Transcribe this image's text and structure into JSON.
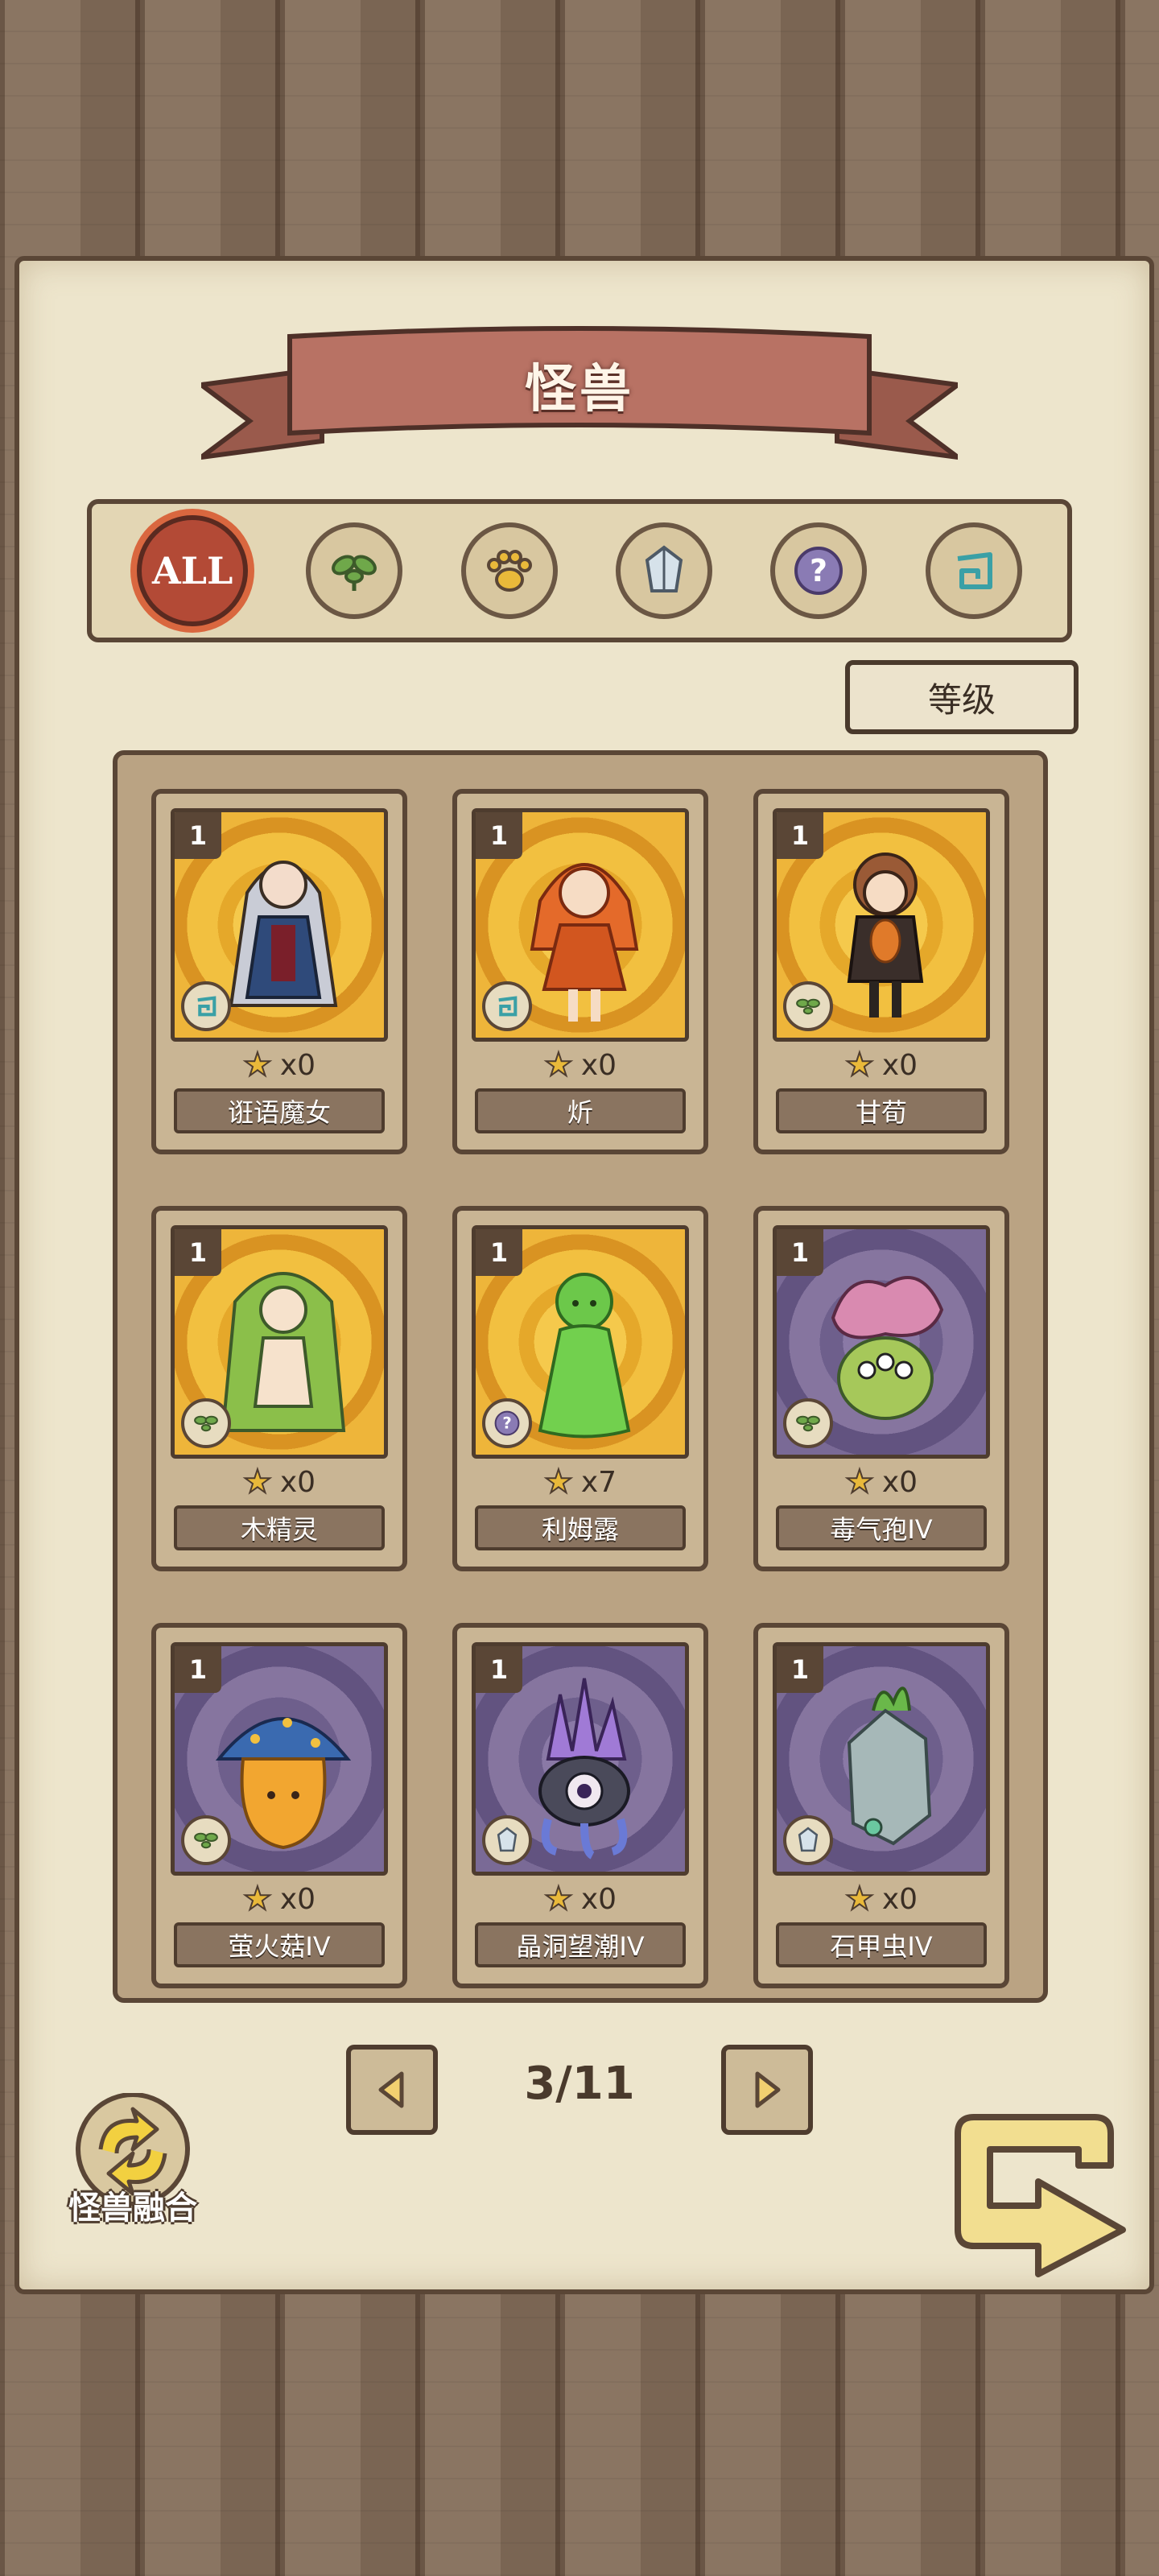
{
  "title": "怪兽",
  "filters": [
    {
      "label": "ALL",
      "icon": "all-icon",
      "active": true
    },
    {
      "label": "",
      "icon": "leaf-icon",
      "active": false
    },
    {
      "label": "",
      "icon": "paw-icon",
      "active": false
    },
    {
      "label": "",
      "icon": "crystal-icon",
      "active": false
    },
    {
      "label": "",
      "icon": "question-icon",
      "active": false
    },
    {
      "label": "",
      "icon": "swirl-icon",
      "active": false
    }
  ],
  "sort_label": "等级",
  "monsters": [
    {
      "level": "1",
      "count": "x0",
      "name": "诳语魔女",
      "type_icon": "swirl-icon",
      "bg": "gold"
    },
    {
      "level": "1",
      "count": "x0",
      "name": "炘",
      "type_icon": "swirl-icon",
      "bg": "gold"
    },
    {
      "level": "1",
      "count": "x0",
      "name": "甘荀",
      "type_icon": "leaf-icon",
      "bg": "gold"
    },
    {
      "level": "1",
      "count": "x0",
      "name": "木精灵",
      "type_icon": "leaf-icon",
      "bg": "gold"
    },
    {
      "level": "1",
      "count": "x7",
      "name": "利姆露",
      "type_icon": "question-icon",
      "bg": "gold"
    },
    {
      "level": "1",
      "count": "x0",
      "name": "毒气孢IV",
      "type_icon": "leaf-icon",
      "bg": "purple"
    },
    {
      "level": "1",
      "count": "x0",
      "name": "萤火菇IV",
      "type_icon": "leaf-icon",
      "bg": "purple"
    },
    {
      "level": "1",
      "count": "x0",
      "name": "晶洞望潮IV",
      "type_icon": "crystal-icon",
      "bg": "purple"
    },
    {
      "level": "1",
      "count": "x0",
      "name": "石甲虫IV",
      "type_icon": "crystal-icon",
      "bg": "purple"
    }
  ],
  "page": "3/11",
  "fusion_label": "怪兽融合",
  "colors": {
    "accent": "#b34a36",
    "gold": "#f2c040",
    "purple": "#7a6a96",
    "wood": "#5a4636"
  }
}
